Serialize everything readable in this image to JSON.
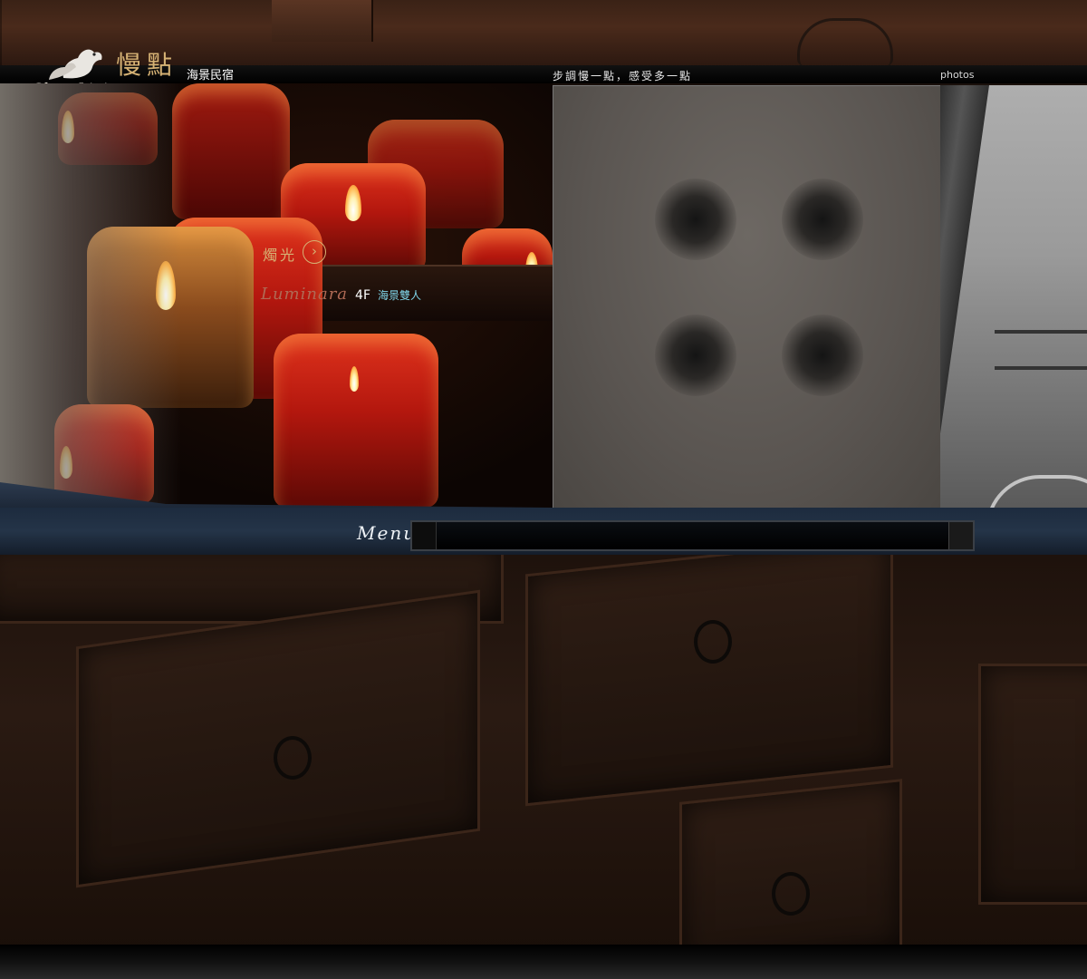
{
  "header": {
    "logo_en": "Slow Living",
    "logo_zh": "慢點",
    "logo_sub": "海景民宿",
    "slogan": "步調慢一點，感受多一點",
    "photos_link": "photos"
  },
  "hero": {
    "caption": "燭光",
    "arrow": "›",
    "room_name": "Luminara",
    "room_floor": "4F",
    "room_type": "海景雙人"
  },
  "menu": {
    "label": "Menu"
  },
  "colors": {
    "accent_gold": "#d6b274",
    "room_type_cyan": "#7fd4e8",
    "menu_blue": "#1d2b3e"
  }
}
